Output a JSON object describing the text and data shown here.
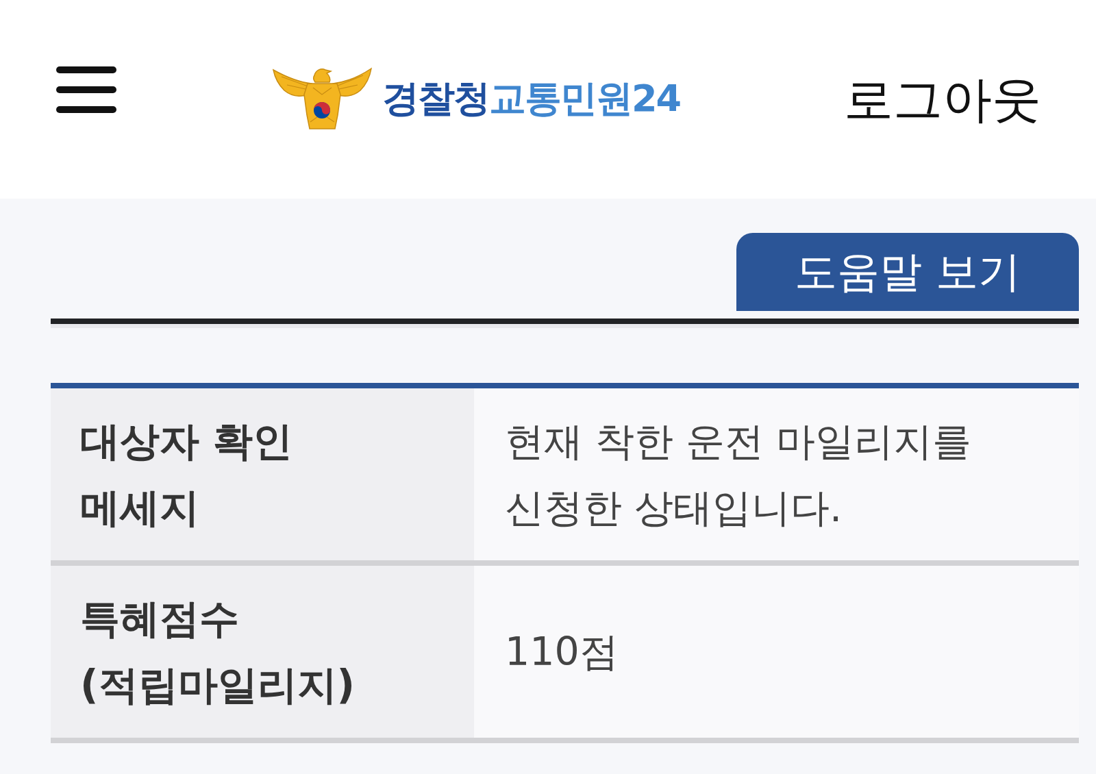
{
  "header": {
    "logo": {
      "agency": "경찰청",
      "service": "교통민원24"
    },
    "logout": "로그아웃"
  },
  "help_button": "도움말 보기",
  "table": {
    "rows": [
      {
        "label": "대상자 확인 메세지",
        "value": "현재 착한 운전 마일리지를 신청한 상태입니다."
      },
      {
        "label": "특혜점수 (적립마일리지)",
        "value": "110점"
      }
    ]
  }
}
